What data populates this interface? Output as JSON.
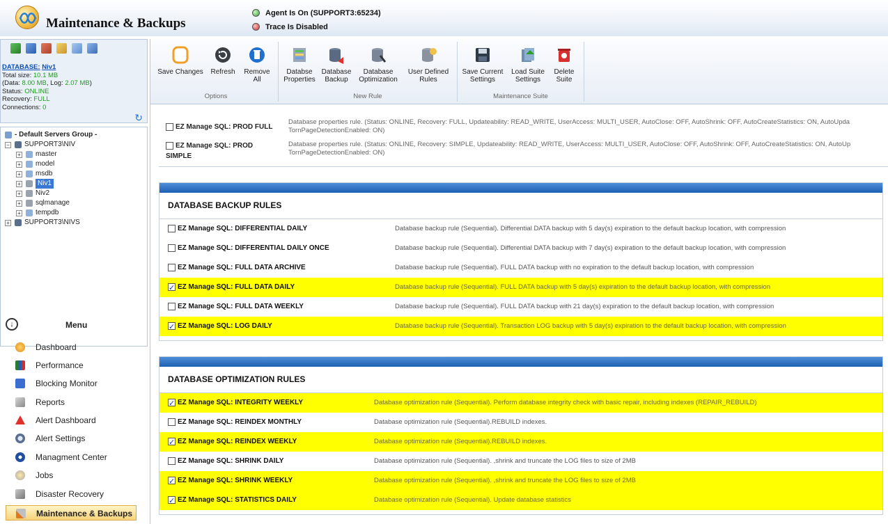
{
  "header": {
    "title": "Maintenance & Backups",
    "agent_status": "Agent Is On (SUPPORT3:65234)",
    "trace_status": "Trace Is Disabled"
  },
  "db_info": {
    "name_label": "DATABASE:",
    "name_value": "Niv1",
    "total_size_label": "Total size:",
    "total_size_value": "10.1 MB",
    "data_prefix": "(Data:",
    "data_value": "8.00 MB",
    "log_label": ", Log:",
    "log_value": "2.07 MB",
    "data_suffix": ")",
    "status_label": "Status:",
    "status_value": "ONLINE",
    "recovery_label": "Recovery:",
    "recovery_value": "FULL",
    "connections_label": "Connections:",
    "connections_value": "0"
  },
  "tree": {
    "group": "- Default Servers Group -",
    "server1": "SUPPORT3\\NIV",
    "databases": [
      "master",
      "model",
      "msdb",
      "Niv1",
      "Niv2",
      "sqlmanage",
      "tempdb"
    ],
    "server2": "SUPPORT3\\NIVS"
  },
  "menu": {
    "title": "Menu",
    "items": [
      "Dashboard",
      "Performance",
      "Blocking Monitor",
      "Reports",
      "Alert Dashboard",
      "Alert Settings",
      "Managment Center",
      "Jobs",
      "Disaster Recovery",
      "Maintenance & Backups"
    ]
  },
  "ribbon": {
    "save_changes": "Save Changes",
    "refresh": "Refresh",
    "remove_all_1": "Remove",
    "remove_all_2": "All",
    "options_group": "Options",
    "db_props_1": "Databse",
    "db_props_2": "Properties",
    "db_backup_1": "Database",
    "db_backup_2": "Backup",
    "db_opt_1": "Database",
    "db_opt_2": "Optimization",
    "user_rules_1": "User Defined",
    "user_rules_2": "Rules",
    "new_rule_group": "New Rule",
    "save_settings_1": "Save Current",
    "save_settings_2": "Settings",
    "load_suite_1": "Load Suite",
    "load_suite_2": "Settings",
    "delete_suite_1": "Delete",
    "delete_suite_2": "Suite",
    "suite_group": "Maintenance Suite"
  },
  "property_rules": [
    {
      "name_1": "EZ Manage SQL: PROD FULL",
      "name_2": "",
      "desc": "Database properties rule. (Status: ONLINE, Recovery: FULL, Updateability: READ_WRITE, UserAccess: MULTI_USER, AutoClose: OFF, AutoShrink: OFF, AutoCreateStatistics: ON, AutoUpda TornPageDetectionEnabled: ON)"
    },
    {
      "name_1": "EZ Manage SQL: PROD",
      "name_2": "SIMPLE",
      "desc": "Database properties rule. (Status: ONLINE, Recovery: SIMPLE, Updateability: READ_WRITE, UserAccess: MULTI_USER, AutoClose: OFF, AutoShrink: OFF, AutoCreateStatistics: ON, AutoUp TornPageDetectionEnabled: ON)"
    }
  ],
  "backup_section": {
    "title": "DATABASE BACKUP RULES",
    "rules": [
      {
        "name": "EZ Manage SQL: DIFFERENTIAL DAILY",
        "desc": "Database backup rule (Sequential). Differential DATA backup with 5 day(s) expiration to the default backup location, with compression",
        "checked": false
      },
      {
        "name": "EZ Manage SQL: DIFFERENTIAL DAILY ONCE",
        "desc": "Database backup rule (Sequential). Differential DATA backup with 7 day(s) expiration to the default backup location, with compression",
        "checked": false
      },
      {
        "name": "EZ Manage SQL: FULL DATA ARCHIVE",
        "desc": "Database backup rule (Sequential). FULL DATA backup with no expiration to the default backup location, with compression",
        "checked": false
      },
      {
        "name": "EZ Manage SQL: FULL DATA DAILY",
        "desc": "Database backup rule (Sequential). FULL DATA backup with 5 day(s) expiration to the default backup location, with compression",
        "checked": true
      },
      {
        "name": "EZ Manage SQL: FULL DATA WEEKLY",
        "desc": "Database backup rule (Sequential). FULL DATA backup with 21 day(s) expiration to the default backup location, with compression",
        "checked": false
      },
      {
        "name": "EZ Manage SQL: LOG DAILY",
        "desc": "Database backup rule (Sequential). Transaction LOG backup with 5 day(s) expiration to the default backup location, with compression",
        "checked": true
      }
    ]
  },
  "optimization_section": {
    "title": "DATABASE OPTIMIZATION RULES",
    "rules": [
      {
        "name": "EZ Manage SQL: INTEGRITY WEEKLY",
        "desc": "Database optimization rule (Sequential). Perform database integrity check with basic repair, including indexes (REPAIR_REBUILD)",
        "checked": true
      },
      {
        "name": "EZ Manage SQL: REINDEX MONTHLY",
        "desc": "Database optimization rule (Sequential).REBUILD indexes.",
        "checked": false
      },
      {
        "name": "EZ Manage SQL: REINDEX WEEKLY",
        "desc": "Database optimization rule (Sequential).REBUILD indexes.",
        "checked": true
      },
      {
        "name": "EZ Manage SQL: SHRINK DAILY",
        "desc": "Database optimization rule (Sequential). ,shrink and truncate the LOG files to size of 2MB",
        "checked": false
      },
      {
        "name": "EZ Manage SQL: SHRINK WEEKLY",
        "desc": "Database optimization rule (Sequential). ,shrink and truncate the LOG files to size of 2MB",
        "checked": true
      },
      {
        "name": "EZ Manage SQL: STATISTICS DAILY",
        "desc": "Database optimization rule (Sequential). Update database statistics",
        "checked": true
      }
    ]
  },
  "colors": {
    "checked_row": "#ffff00",
    "section_bar": "#1d5fb3",
    "menu_active": "#f7d37a"
  }
}
